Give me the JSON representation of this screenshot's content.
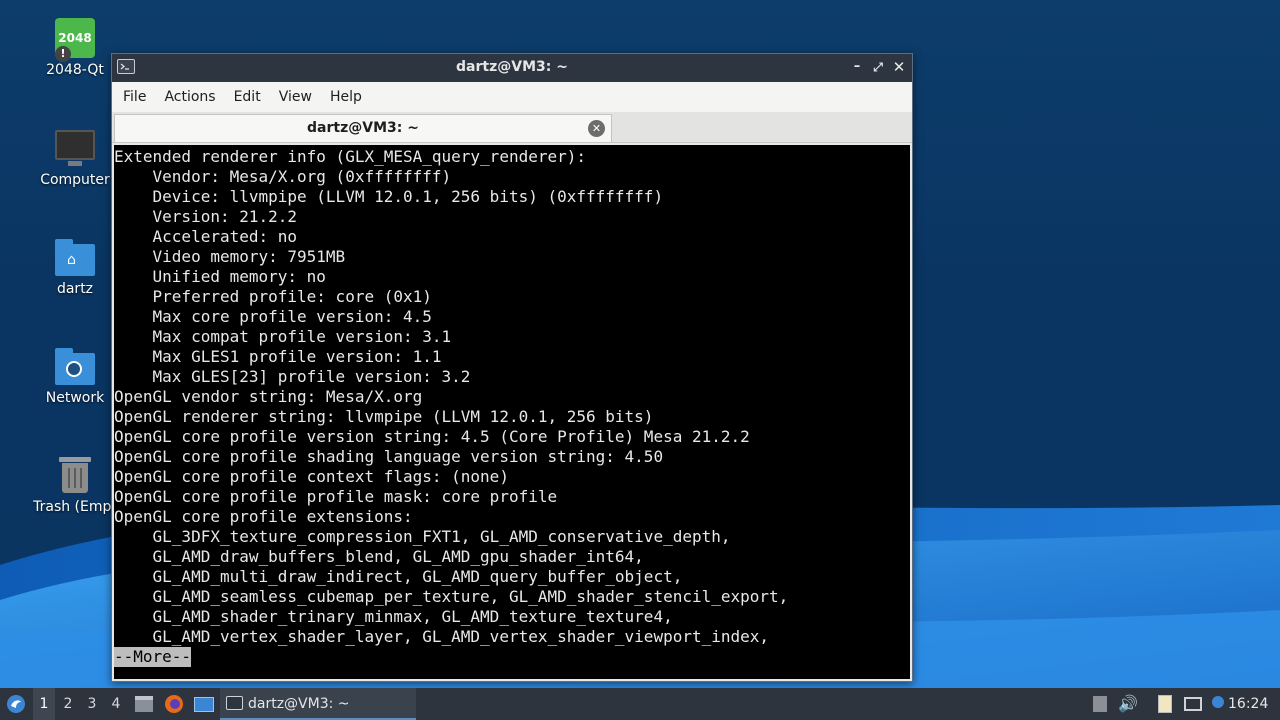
{
  "desktop": {
    "icons": [
      {
        "label": "2048-Qt",
        "icon": "2048-game-icon",
        "glyph_text": "2048"
      },
      {
        "label": "Computer",
        "icon": "computer-icon"
      },
      {
        "label": "dartz",
        "icon": "home-folder-icon"
      },
      {
        "label": "Network",
        "icon": "network-folder-icon"
      },
      {
        "label": "Trash (Empt",
        "icon": "trash-icon"
      }
    ]
  },
  "window": {
    "title": "dartz@VM3: ~",
    "menu": [
      "File",
      "Actions",
      "Edit",
      "View",
      "Help"
    ],
    "tab_label": "dartz@VM3: ~",
    "terminal": {
      "lines": [
        "Extended renderer info (GLX_MESA_query_renderer):",
        "    Vendor: Mesa/X.org (0xffffffff)",
        "    Device: llvmpipe (LLVM 12.0.1, 256 bits) (0xffffffff)",
        "    Version: 21.2.2",
        "    Accelerated: no",
        "    Video memory: 7951MB",
        "    Unified memory: no",
        "    Preferred profile: core (0x1)",
        "    Max core profile version: 4.5",
        "    Max compat profile version: 3.1",
        "    Max GLES1 profile version: 1.1",
        "    Max GLES[23] profile version: 3.2",
        "OpenGL vendor string: Mesa/X.org",
        "OpenGL renderer string: llvmpipe (LLVM 12.0.1, 256 bits)",
        "OpenGL core profile version string: 4.5 (Core Profile) Mesa 21.2.2",
        "OpenGL core profile shading language version string: 4.50",
        "OpenGL core profile context flags: (none)",
        "OpenGL core profile profile mask: core profile",
        "OpenGL core profile extensions:",
        "    GL_3DFX_texture_compression_FXT1, GL_AMD_conservative_depth,",
        "    GL_AMD_draw_buffers_blend, GL_AMD_gpu_shader_int64,",
        "    GL_AMD_multi_draw_indirect, GL_AMD_query_buffer_object,",
        "    GL_AMD_seamless_cubemap_per_texture, GL_AMD_shader_stencil_export,",
        "    GL_AMD_shader_trinary_minmax, GL_AMD_texture_texture4,",
        "    GL_AMD_vertex_shader_layer, GL_AMD_vertex_shader_viewport_index,"
      ],
      "pager_prompt": "--More--"
    }
  },
  "taskbar": {
    "workspaces": [
      "1",
      "2",
      "3",
      "4"
    ],
    "active_workspace": "1",
    "task_label": "dartz@VM3: ~",
    "clock": "16:24"
  },
  "colors": {
    "wallpaper_dark": "#0a3562",
    "wallpaper_light": "#2f8fe0",
    "titlebar": "#2d3540",
    "taskbar": "#2d343d",
    "terminal_bg": "#000000",
    "terminal_fg": "#e8e8e8"
  }
}
